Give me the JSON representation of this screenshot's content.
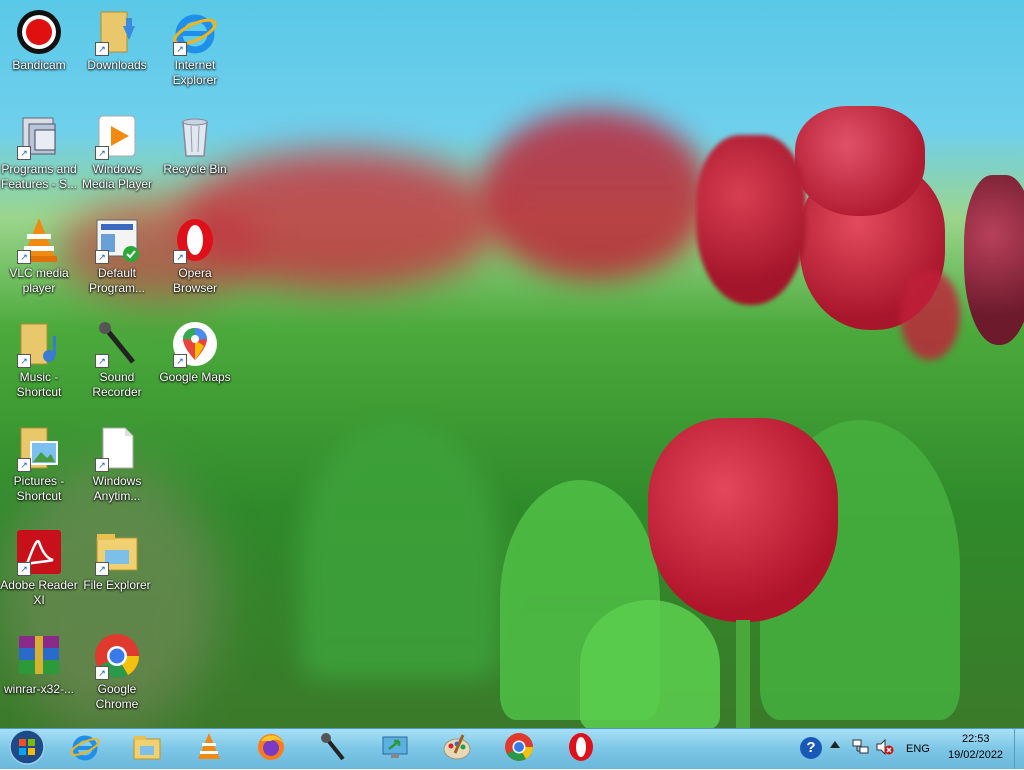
{
  "desktop": {
    "icons": [
      {
        "label": "Bandicam",
        "icon": "bandicam-icon"
      },
      {
        "label": "Downloads",
        "icon": "downloads-folder-icon"
      },
      {
        "label": "Internet Explorer",
        "icon": "internet-explorer-icon"
      },
      {
        "label": "Programs and Features - S...",
        "icon": "programs-features-icon"
      },
      {
        "label": "Windows Media Player",
        "icon": "windows-media-player-icon"
      },
      {
        "label": "Recycle Bin",
        "icon": "recycle-bin-icon"
      },
      {
        "label": "VLC media player",
        "icon": "vlc-icon"
      },
      {
        "label": "Default Program...",
        "icon": "default-programs-icon"
      },
      {
        "label": "Opera Browser",
        "icon": "opera-icon"
      },
      {
        "label": "Music - Shortcut",
        "icon": "music-folder-icon"
      },
      {
        "label": "Sound Recorder",
        "icon": "microphone-icon"
      },
      {
        "label": "Google Maps",
        "icon": "google-maps-icon"
      },
      {
        "label": "Pictures - Shortcut",
        "icon": "pictures-folder-icon"
      },
      {
        "label": "Windows Anytim...",
        "icon": "document-icon"
      },
      {
        "label": "Adobe Reader XI",
        "icon": "adobe-reader-icon"
      },
      {
        "label": "File Explorer",
        "icon": "file-explorer-icon"
      },
      {
        "label": "winrar-x32-...",
        "icon": "winrar-icon"
      },
      {
        "label": "Google Chrome",
        "icon": "chrome-icon"
      }
    ]
  },
  "taskbar": {
    "pinned": [
      "start-orb-icon",
      "internet-explorer-icon",
      "file-explorer-icon",
      "vlc-icon",
      "firefox-icon",
      "microphone-icon",
      "remote-desktop-icon",
      "paint-icon",
      "chrome-icon",
      "opera-icon"
    ],
    "tray": {
      "language": "ENG",
      "time": "22:53",
      "date": "19/02/2022"
    }
  }
}
